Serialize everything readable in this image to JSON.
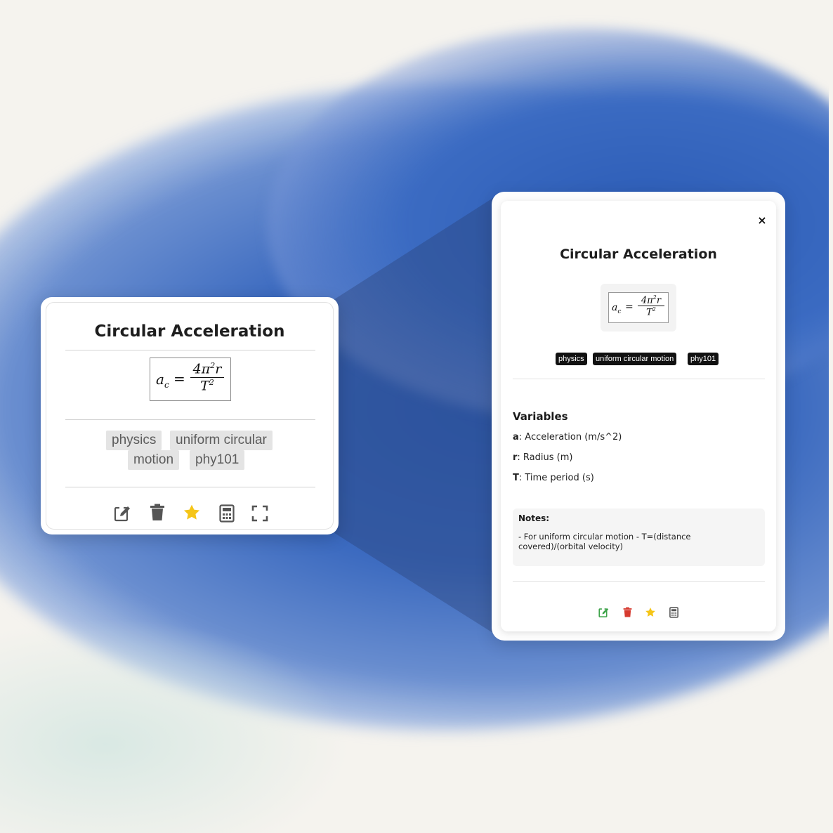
{
  "formula_card": {
    "title": "Circular Acceleration",
    "formula": {
      "lhs": "a",
      "lhs_sub": "c",
      "equals": "=",
      "numerator": "4π",
      "numerator_sup": "2",
      "numerator_tail": "r",
      "denominator": "T",
      "denominator_sup": "2"
    },
    "tags": [
      "physics",
      "uniform circular",
      "motion",
      "phy101"
    ],
    "actions": [
      "edit-icon",
      "trash-icon",
      "star-icon",
      "calculator-icon",
      "fullscreen-icon"
    ]
  },
  "detail_modal": {
    "close_label": "×",
    "title": "Circular Acceleration",
    "tags": [
      "physics",
      "uniform circular motion",
      "phy101"
    ],
    "variables_heading": "Variables",
    "variables": [
      {
        "symbol": "a",
        "desc": ": Acceleration (m/s^2)"
      },
      {
        "symbol": "r",
        "desc": ": Radius (m)"
      },
      {
        "symbol": "T",
        "desc": ": Time period (s)"
      }
    ],
    "notes_heading": "Notes:",
    "notes_text": "- For uniform circular motion - T=(distance covered)/(orbital velocity)",
    "actions": [
      "edit-icon",
      "trash-icon",
      "star-icon",
      "calculator-icon"
    ]
  },
  "colors": {
    "edit_green": "#3ea34a",
    "delete_red": "#d63a2f",
    "star_yellow": "#f5c518",
    "icon_gray": "#555555"
  }
}
